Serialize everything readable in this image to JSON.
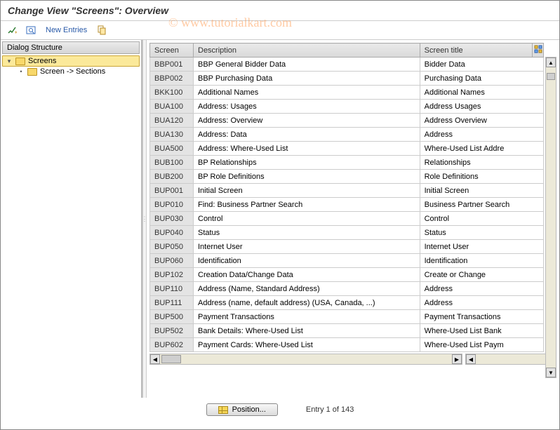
{
  "title": "Change View \"Screens\": Overview",
  "toolbar": {
    "new_entries_label": "New Entries"
  },
  "watermark": "© www.tutorialkart.com",
  "tree": {
    "header": "Dialog Structure",
    "root_label": "Screens",
    "child_label": "Screen -> Sections"
  },
  "columns": {
    "screen": "Screen",
    "description": "Description",
    "screen_title": "Screen title"
  },
  "rows": [
    {
      "code": "BBP001",
      "desc": "BBP General Bidder Data",
      "title": "Bidder Data"
    },
    {
      "code": "BBP002",
      "desc": "BBP Purchasing Data",
      "title": "Purchasing Data"
    },
    {
      "code": "BKK100",
      "desc": "Additional Names",
      "title": "Additional Names"
    },
    {
      "code": "BUA100",
      "desc": "Address: Usages",
      "title": "Address Usages"
    },
    {
      "code": "BUA120",
      "desc": "Address: Overview",
      "title": "Address Overview"
    },
    {
      "code": "BUA130",
      "desc": "Address: Data",
      "title": "Address"
    },
    {
      "code": "BUA500",
      "desc": "Address: Where-Used List",
      "title": "Where-Used List Addre"
    },
    {
      "code": "BUB100",
      "desc": "BP Relationships",
      "title": "Relationships"
    },
    {
      "code": "BUB200",
      "desc": "BP Role Definitions",
      "title": "Role Definitions"
    },
    {
      "code": "BUP001",
      "desc": "Initial Screen",
      "title": "Initial Screen"
    },
    {
      "code": "BUP010",
      "desc": "Find: Business Partner Search",
      "title": "Business Partner Search"
    },
    {
      "code": "BUP030",
      "desc": "Control",
      "title": "Control"
    },
    {
      "code": "BUP040",
      "desc": "Status",
      "title": "Status"
    },
    {
      "code": "BUP050",
      "desc": "Internet User",
      "title": "Internet User"
    },
    {
      "code": "BUP060",
      "desc": "Identification",
      "title": "Identification"
    },
    {
      "code": "BUP102",
      "desc": "Creation Data/Change Data",
      "title": "Create or Change"
    },
    {
      "code": "BUP110",
      "desc": "Address (Name, Standard Address)",
      "title": "Address"
    },
    {
      "code": "BUP111",
      "desc": "Address (name, default address) (USA, Canada, ...)",
      "title": "Address"
    },
    {
      "code": "BUP500",
      "desc": "Payment Transactions",
      "title": "Payment Transactions"
    },
    {
      "code": "BUP502",
      "desc": "Bank Details: Where-Used List",
      "title": "Where-Used List Bank"
    },
    {
      "code": "BUP602",
      "desc": "Payment Cards: Where-Used List",
      "title": "Where-Used List Paym"
    }
  ],
  "footer": {
    "position_label": "Position...",
    "entry_label": "Entry 1 of 143"
  }
}
